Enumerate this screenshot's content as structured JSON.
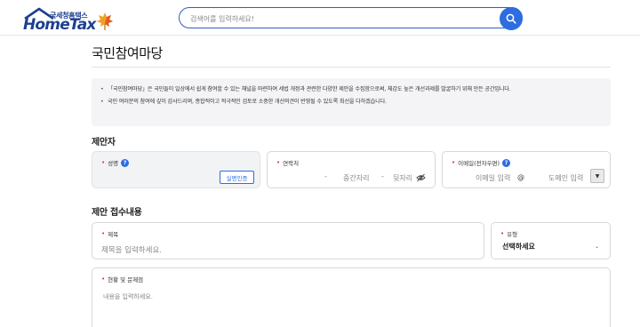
{
  "header": {
    "logo_sub": "국세청홈택스",
    "logo_main": "HomeTax",
    "search_placeholder": "검색어를 입력하세요!"
  },
  "page": {
    "title": "국민참여마당",
    "notices": [
      "「국민참여마당」은 국민들이 일상에서 쉽게 참여할 수 있는 채널을 마련하여 세법 개정과 관련한 다양한 제안을 수집함으로써, 체감도 높은 개선과제를 발굴하기 위해 만든 공간입니다.",
      "국민 여러분의 참여에 깊이 감사드리며, 종합적이고 적극적인 검토로 소중한 개선의견이 반영될 수 있도록 최선을 다하겠습니다."
    ]
  },
  "proposer": {
    "section_title": "제안자",
    "name_label": "성명",
    "verify_button": "실명인증",
    "contact_label": "연락처",
    "contact_dash": "-",
    "contact_mid": "중간자리",
    "contact_last": "뒷자리",
    "email_label": "이메일(전자우편)",
    "email_placeholder": "이메일 입력",
    "email_at": "@",
    "domain_placeholder": "도메인 입력"
  },
  "receipt": {
    "section_title": "제안 접수내용",
    "subject_label": "제목",
    "subject_placeholder": "제목을 입력하세요.",
    "type_label": "유형",
    "type_value": "선택하세요",
    "issue_label": "현황 및 문제점",
    "issue_placeholder": "내용을 입력하세요."
  },
  "colors": {
    "brand_blue": "#1e3f91",
    "accent_blue": "#2d6de0",
    "required_red": "#e0303c"
  }
}
